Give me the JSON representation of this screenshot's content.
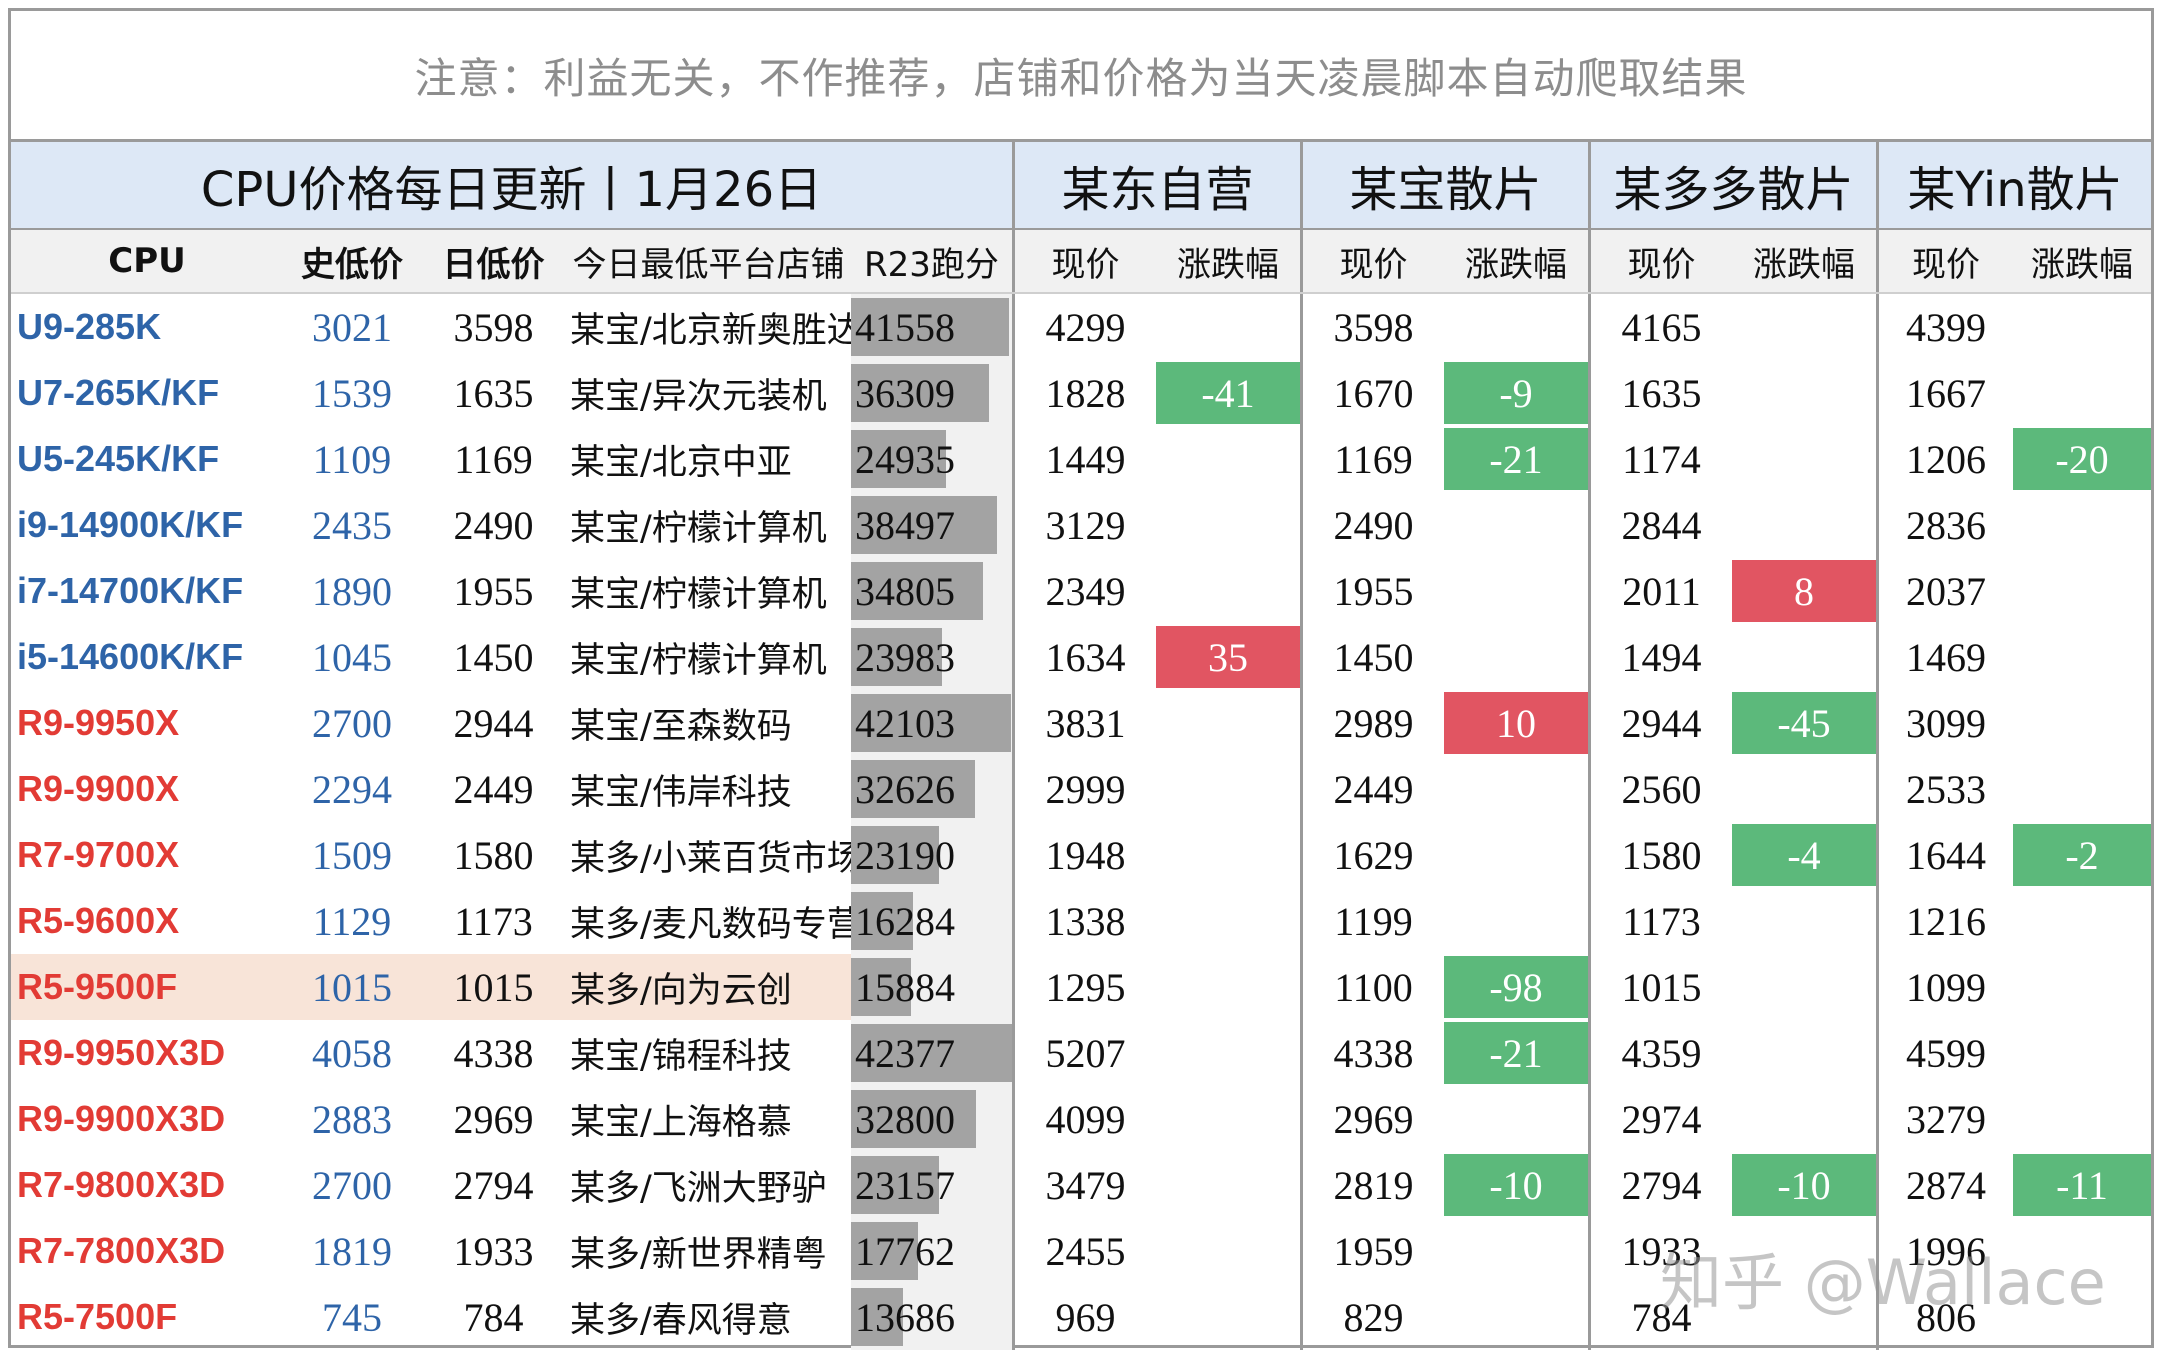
{
  "notice": "注意：利益无关，不作推荐，店铺和价格为当天凌晨脚本自动爬取结果",
  "title": "CPU价格每日更新丨1月26日",
  "platforms": [
    "某东自营",
    "某宝散片",
    "某多多散片",
    "某Yin散片"
  ],
  "columns": {
    "cpu": "CPU",
    "hist_low": "史低价",
    "day_low": "日低价",
    "shop": "今日最低平台店铺",
    "r23": "R23跑分",
    "now": "现价",
    "change": "涨跌幅"
  },
  "colors": {
    "intel": "#2e64a8",
    "amd": "#e23b35",
    "up": "#e15562",
    "down": "#5cb97b",
    "header": "#dde8f6"
  },
  "rows": [
    {
      "cpu": "U9-285K",
      "brand": "intel",
      "hist": "3021",
      "day": "3598",
      "shop": "某宝/北京新奥胜达",
      "r23": "41558",
      "r23_value": 41558,
      "p": [
        [
          "4299",
          ""
        ],
        [
          "3598",
          ""
        ],
        [
          "4165",
          ""
        ],
        [
          "4399",
          ""
        ]
      ]
    },
    {
      "cpu": "U7-265K/KF",
      "brand": "intel",
      "hist": "1539",
      "day": "1635",
      "shop": "某宝/异次元装机",
      "r23": "36309",
      "r23_value": 36309,
      "p": [
        [
          "1828",
          "-41"
        ],
        [
          "1670",
          "-9"
        ],
        [
          "1635",
          ""
        ],
        [
          "1667",
          ""
        ]
      ]
    },
    {
      "cpu": "U5-245K/KF",
      "brand": "intel",
      "hist": "1109",
      "day": "1169",
      "shop": "某宝/北京中亚",
      "r23": "24935",
      "r23_value": 24935,
      "p": [
        [
          "1449",
          ""
        ],
        [
          "1169",
          "-21"
        ],
        [
          "1174",
          ""
        ],
        [
          "1206",
          "-20"
        ]
      ]
    },
    {
      "cpu": "i9-14900K/KF",
      "brand": "intel",
      "hist": "2435",
      "day": "2490",
      "shop": "某宝/柠檬计算机",
      "r23": "38497",
      "r23_value": 38497,
      "p": [
        [
          "3129",
          ""
        ],
        [
          "2490",
          ""
        ],
        [
          "2844",
          ""
        ],
        [
          "2836",
          ""
        ]
      ]
    },
    {
      "cpu": "i7-14700K/KF",
      "brand": "intel",
      "hist": "1890",
      "day": "1955",
      "shop": "某宝/柠檬计算机",
      "r23": "34805",
      "r23_value": 34805,
      "p": [
        [
          "2349",
          ""
        ],
        [
          "1955",
          ""
        ],
        [
          "2011",
          "8"
        ],
        [
          "2037",
          ""
        ]
      ]
    },
    {
      "cpu": "i5-14600K/KF",
      "brand": "intel",
      "hist": "1045",
      "day": "1450",
      "shop": "某宝/柠檬计算机",
      "r23": "23983",
      "r23_value": 23983,
      "p": [
        [
          "1634",
          "35"
        ],
        [
          "1450",
          ""
        ],
        [
          "1494",
          ""
        ],
        [
          "1469",
          ""
        ]
      ]
    },
    {
      "cpu": "R9-9950X",
      "brand": "amd",
      "hist": "2700",
      "day": "2944",
      "shop": "某宝/至森数码",
      "r23": "42103",
      "r23_value": 42103,
      "p": [
        [
          "3831",
          ""
        ],
        [
          "2989",
          "10"
        ],
        [
          "2944",
          "-45"
        ],
        [
          "3099",
          ""
        ]
      ]
    },
    {
      "cpu": "R9-9900X",
      "brand": "amd",
      "hist": "2294",
      "day": "2449",
      "shop": "某宝/伟岸科技",
      "r23": "32626",
      "r23_value": 32626,
      "p": [
        [
          "2999",
          ""
        ],
        [
          "2449",
          ""
        ],
        [
          "2560",
          ""
        ],
        [
          "2533",
          ""
        ]
      ]
    },
    {
      "cpu": "R7-9700X",
      "brand": "amd",
      "hist": "1509",
      "day": "1580",
      "shop": "某多/小莱百货市场",
      "r23": "23190",
      "r23_value": 23190,
      "p": [
        [
          "1948",
          ""
        ],
        [
          "1629",
          ""
        ],
        [
          "1580",
          "-4"
        ],
        [
          "1644",
          "-2"
        ]
      ]
    },
    {
      "cpu": "R5-9600X",
      "brand": "amd",
      "hist": "1129",
      "day": "1173",
      "shop": "某多/麦凡数码专营",
      "r23": "16284",
      "r23_value": 16284,
      "p": [
        [
          "1338",
          ""
        ],
        [
          "1199",
          ""
        ],
        [
          "1173",
          ""
        ],
        [
          "1216",
          ""
        ]
      ]
    },
    {
      "cpu": "R5-9500F",
      "brand": "amd",
      "hist": "1015",
      "day": "1015",
      "shop": "某多/向为云创",
      "r23": "15884",
      "r23_value": 15884,
      "highlight": true,
      "p": [
        [
          "1295",
          ""
        ],
        [
          "1100",
          "-98"
        ],
        [
          "1015",
          ""
        ],
        [
          "1099",
          ""
        ]
      ]
    },
    {
      "cpu": "R9-9950X3D",
      "brand": "amd",
      "hist": "4058",
      "day": "4338",
      "shop": "某宝/锦程科技",
      "r23": "42377",
      "r23_value": 42377,
      "p": [
        [
          "5207",
          ""
        ],
        [
          "4338",
          "-21"
        ],
        [
          "4359",
          ""
        ],
        [
          "4599",
          ""
        ]
      ]
    },
    {
      "cpu": "R9-9900X3D",
      "brand": "amd",
      "hist": "2883",
      "day": "2969",
      "shop": "某宝/上海格慕",
      "r23": "32800",
      "r23_value": 32800,
      "p": [
        [
          "4099",
          ""
        ],
        [
          "2969",
          ""
        ],
        [
          "2974",
          ""
        ],
        [
          "3279",
          ""
        ]
      ]
    },
    {
      "cpu": "R7-9800X3D",
      "brand": "amd",
      "hist": "2700",
      "day": "2794",
      "shop": "某多/飞洲大野驴",
      "r23": "23157",
      "r23_value": 23157,
      "p": [
        [
          "3479",
          ""
        ],
        [
          "2819",
          "-10"
        ],
        [
          "2794",
          "-10"
        ],
        [
          "2874",
          "-11"
        ]
      ]
    },
    {
      "cpu": "R7-7800X3D",
      "brand": "amd",
      "hist": "1819",
      "day": "1933",
      "shop": "某多/新世界精粤",
      "r23": "17762",
      "r23_value": 17762,
      "p": [
        [
          "2455",
          ""
        ],
        [
          "1959",
          ""
        ],
        [
          "1933",
          ""
        ],
        [
          "1996",
          ""
        ]
      ]
    },
    {
      "cpu": "R5-7500F",
      "brand": "amd",
      "hist": "745",
      "day": "784",
      "shop": "某多/春风得意",
      "r23": "13686",
      "r23_value": 13686,
      "p": [
        [
          "969",
          ""
        ],
        [
          "829",
          ""
        ],
        [
          "784",
          ""
        ],
        [
          "806",
          ""
        ]
      ]
    }
  ],
  "r23_max": 42377,
  "watermark": "知乎 @Wallace"
}
